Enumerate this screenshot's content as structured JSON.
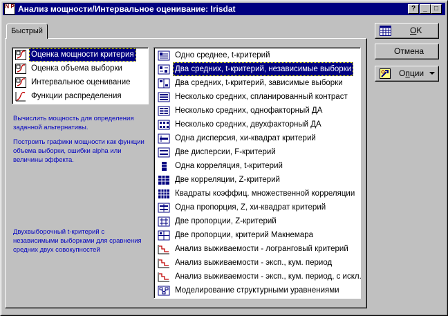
{
  "window": {
    "title": "Анализ мощности/Интервальное оценивание: Irisdat",
    "icon_text": "N P",
    "controls": [
      "?",
      "_",
      "□",
      "×"
    ]
  },
  "tab": {
    "label": "Быстрый"
  },
  "left_list": {
    "items": [
      {
        "label": "Оценка мощности критерия",
        "icon": "power-chart-icon",
        "selected": true
      },
      {
        "label": "Оценка объема выборки",
        "icon": "power-chart-icon",
        "selected": false
      },
      {
        "label": "Интервальное оценивание",
        "icon": "power-chart-icon",
        "selected": false
      },
      {
        "label": "Функции распределения",
        "icon": "distribution-curve-icon",
        "selected": false
      }
    ]
  },
  "descriptions": {
    "p1": "Вычислить мощность для определения заданной альтернативы.",
    "p2": "Построить графики мощности как функции объема выборки, ошибки alpha или величины эффекта.",
    "p3": "Двухвыборочный t-критерий с независимыми выборками для сравнения средних двух совокупностей"
  },
  "right_list": {
    "items": [
      {
        "label": "Одно среднее, t-критерий",
        "icon": "one-mean-icon",
        "selected": false
      },
      {
        "label": "Два средних, t-критерий, независимые выборки",
        "icon": "two-means-icon",
        "selected": true
      },
      {
        "label": "Два средних, t-критерий, зависимые выборки",
        "icon": "two-means-dependent-icon",
        "selected": false
      },
      {
        "label": "Несколько средних, спланированный контраст",
        "icon": "contrast-icon",
        "selected": false
      },
      {
        "label": "Несколько средних, однофакторный ДА",
        "icon": "anova-one-icon",
        "selected": false
      },
      {
        "label": "Несколько средних, двухфакторный ДА",
        "icon": "anova-two-icon",
        "selected": false
      },
      {
        "label": "Одна дисперсия, хи-квадрат критерий",
        "icon": "one-variance-icon",
        "selected": false
      },
      {
        "label": "Две дисперсии, F-критерий",
        "icon": "two-variances-icon",
        "selected": false
      },
      {
        "label": "Одна корреляция, t-критерий",
        "icon": "one-correlation-icon",
        "selected": false
      },
      {
        "label": "Две корреляции, Z-критерий",
        "icon": "two-correlations-icon",
        "selected": false
      },
      {
        "label": "Квадраты коэффиц. множественной корреляции",
        "icon": "multiple-correlation-icon",
        "selected": false
      },
      {
        "label": "Одна пропорция, Z, хи-квадрат критерий",
        "icon": "one-proportion-icon",
        "selected": false
      },
      {
        "label": "Две пропорции, Z-критерий",
        "icon": "two-proportions-icon",
        "selected": false
      },
      {
        "label": "Две пропорции, критерий Макнемара",
        "icon": "mcnemar-icon",
        "selected": false
      },
      {
        "label": "Анализ выживаемости - логранговый критерий",
        "icon": "survival-curve-icon",
        "selected": false
      },
      {
        "label": "Анализ выживаемости - эксп., кум. период",
        "icon": "survival-curve-icon",
        "selected": false
      },
      {
        "label": "Анализ выживаемости - эксп., кум. период, с искл.",
        "icon": "survival-curve-icon",
        "selected": false
      },
      {
        "label": "Моделирование структурными уравнениями",
        "icon": "sem-icon",
        "selected": false
      }
    ]
  },
  "buttons": {
    "ok": {
      "accel": "O",
      "rest": "K"
    },
    "cancel": "Отмена",
    "options": {
      "accel": "п",
      "before": "О",
      "after": "ции"
    }
  },
  "colors": {
    "selection": "#000080",
    "description_text": "#0000c0",
    "title_bar": "#000080"
  }
}
